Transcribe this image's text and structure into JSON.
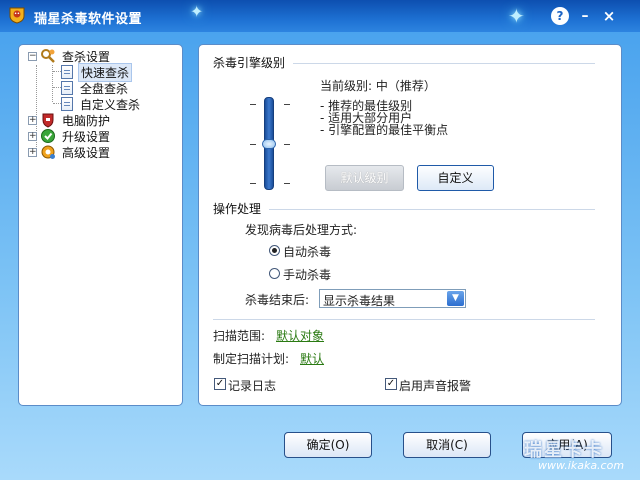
{
  "window": {
    "title": "瑞星杀毒软件设置"
  },
  "titlebar": {
    "help": "?",
    "minimize": "–",
    "close": "×"
  },
  "tree": {
    "items": [
      {
        "label": "查杀设置",
        "expander": "⊟"
      },
      {
        "label": "快速查杀"
      },
      {
        "label": "全盘查杀"
      },
      {
        "label": "自定义查杀"
      },
      {
        "label": "电脑防护",
        "expander": "⊞"
      },
      {
        "label": "升级设置",
        "expander": "⊞"
      },
      {
        "label": "高级设置",
        "expander": "⊞"
      }
    ]
  },
  "engine": {
    "title": "杀毒引擎级别",
    "current_level": "当前级别: 中（推荐）",
    "bullets": [
      "- 推荐的最佳级别",
      "- 适用大部分用户",
      "- 引擎配置的最佳平衡点"
    ],
    "default_button": "默认级别",
    "custom_button": "自定义",
    "slider_level": 0.5
  },
  "operation": {
    "title": "操作处理",
    "prompt": "发现病毒后处理方式:",
    "radio_auto": "自动杀毒",
    "radio_manual": "手动杀毒",
    "selected": "auto",
    "after_label": "杀毒结束后:",
    "after_value": "显示杀毒结果"
  },
  "scan": {
    "range_label": "扫描范围:",
    "range_link": "默认对象",
    "plan_label": "制定扫描计划:",
    "plan_link": "默认"
  },
  "options": {
    "log_label": "记录日志",
    "log_checked": true,
    "sound_label": "启用声音报警",
    "sound_checked": true
  },
  "footer": {
    "ok": "确定(O)",
    "cancel": "取消(C)",
    "apply": "应用(A)"
  },
  "watermark": {
    "logo": "瑞星卡卡",
    "url": "www.ikaka.com"
  }
}
